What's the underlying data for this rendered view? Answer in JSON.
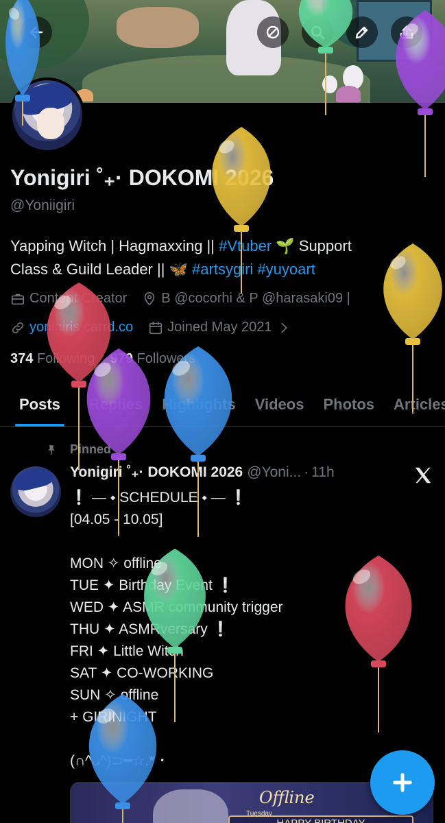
{
  "profile": {
    "display_name": "Yonigiri ˚₊· DOKOMI 2026",
    "handle": "@Yoniigiri",
    "bio_line1_plain": "Yapping Witch | Hagmaxxing || ",
    "bio_line1_tag": "#Vtuber",
    "bio_line1_after": " 🌱 Support",
    "bio_line2_plain": "Class & Guild Leader || 🦋 ",
    "bio_line2_tag1": "#artsygiri",
    "bio_line2_tag2": "#yuyoart",
    "category": "Content Creator",
    "location": "B @cocorhi & P @harasaki09 |",
    "website": "yonigiris.carrd.co",
    "joined": "Joined May 2021",
    "following_count": "374",
    "following_label": "Following",
    "followers_count": "979",
    "followers_label": "Followers"
  },
  "tabs": [
    "Posts",
    "Replies",
    "Highlights",
    "Videos",
    "Photos",
    "Articles"
  ],
  "post": {
    "pinned_label": "Pinned",
    "author_name": "Yonigiri ˚₊· DOKOMI 2026",
    "author_handle": "@Yoni...",
    "separator": "·",
    "time": "11h",
    "body": "❕ — ⬩ SCHEDULE ⬩ — ❕\n[04.05 - 10.05]\n\nMON ✧ offline\nTUE ✦ Birthday Event ❕\nWED ✦ ASMR community trigger\nTHU ✦ ASMRversary ❕\nFRI ✦ Little Witch\nSAT ✦ CO-WORKING\nSUN ✧ offline\n+ GIRINIGHT\n\n(∩^ᴗ^)⊃━☆.* ･",
    "media_title": "Offline",
    "media_day": "Tuesday",
    "media_banner": "HAPPY BIRTHDAY"
  },
  "colors": {
    "accent": "#1d9bf0",
    "muted": "#71767b",
    "text": "#e7e9ea",
    "background": "#000000"
  },
  "icons": [
    "back-arrow-icon",
    "no-grok-icon",
    "search-icon",
    "edit-icon",
    "share-icon",
    "briefcase-icon",
    "location-pin-icon",
    "link-icon",
    "calendar-icon",
    "chevron-right-icon",
    "pin-icon",
    "x-logo-icon",
    "plus-icon",
    "balloon-icon"
  ]
}
